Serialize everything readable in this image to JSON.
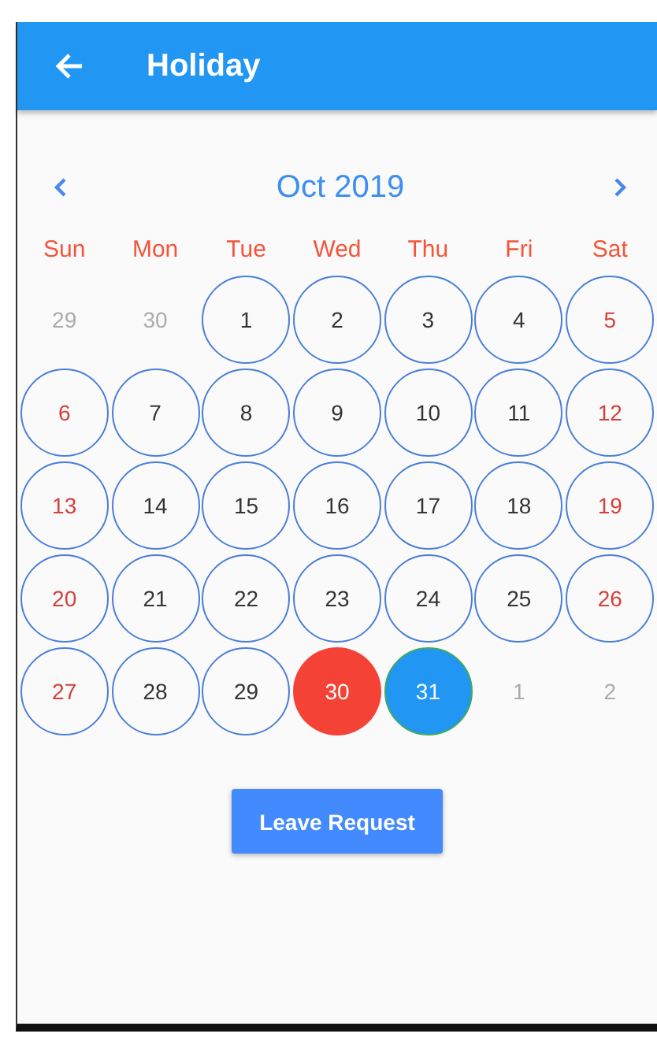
{
  "app_bar": {
    "title": "Holiday"
  },
  "calendar": {
    "month": "Oct 2019",
    "weekdays": [
      "Sun",
      "Mon",
      "Tue",
      "Wed",
      "Thu",
      "Fri",
      "Sat"
    ],
    "days": [
      {
        "label": "29",
        "kind": "outside"
      },
      {
        "label": "30",
        "kind": "outside"
      },
      {
        "label": "1",
        "kind": "normal"
      },
      {
        "label": "2",
        "kind": "normal"
      },
      {
        "label": "3",
        "kind": "normal"
      },
      {
        "label": "4",
        "kind": "normal"
      },
      {
        "label": "5",
        "kind": "weekend"
      },
      {
        "label": "6",
        "kind": "weekend"
      },
      {
        "label": "7",
        "kind": "normal"
      },
      {
        "label": "8",
        "kind": "normal"
      },
      {
        "label": "9",
        "kind": "normal"
      },
      {
        "label": "10",
        "kind": "normal"
      },
      {
        "label": "11",
        "kind": "normal"
      },
      {
        "label": "12",
        "kind": "weekend"
      },
      {
        "label": "13",
        "kind": "weekend"
      },
      {
        "label": "14",
        "kind": "normal"
      },
      {
        "label": "15",
        "kind": "normal"
      },
      {
        "label": "16",
        "kind": "normal"
      },
      {
        "label": "17",
        "kind": "normal"
      },
      {
        "label": "18",
        "kind": "normal"
      },
      {
        "label": "19",
        "kind": "weekend"
      },
      {
        "label": "20",
        "kind": "weekend"
      },
      {
        "label": "21",
        "kind": "normal"
      },
      {
        "label": "22",
        "kind": "normal"
      },
      {
        "label": "23",
        "kind": "normal"
      },
      {
        "label": "24",
        "kind": "normal"
      },
      {
        "label": "25",
        "kind": "normal"
      },
      {
        "label": "26",
        "kind": "weekend"
      },
      {
        "label": "27",
        "kind": "weekend"
      },
      {
        "label": "28",
        "kind": "normal"
      },
      {
        "label": "29",
        "kind": "normal"
      },
      {
        "label": "30",
        "kind": "holiday"
      },
      {
        "label": "31",
        "kind": "today"
      },
      {
        "label": "1",
        "kind": "outside"
      },
      {
        "label": "2",
        "kind": "outside"
      }
    ]
  },
  "button": {
    "label": "Leave Request"
  }
}
